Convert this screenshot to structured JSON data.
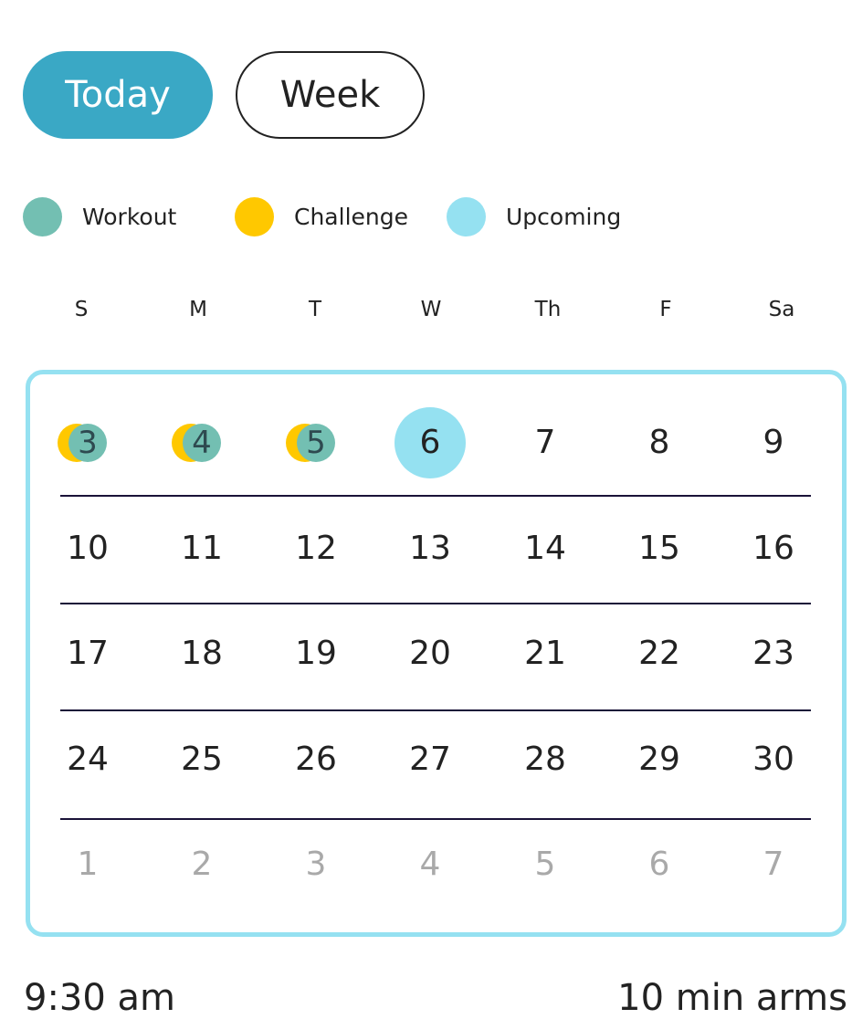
{
  "toggles": {
    "today": "Today",
    "week": "Week"
  },
  "legend": [
    {
      "label": "Workout",
      "color": "#73bfb2"
    },
    {
      "label": "Challenge",
      "color": "#ffc800"
    },
    {
      "label": "Upcoming",
      "color": "#95e1f1"
    }
  ],
  "weekdays": [
    "S",
    "M",
    "T",
    "W",
    "Th",
    "F",
    "Sa"
  ],
  "weeks": [
    [
      "3",
      "4",
      "5",
      "6",
      "7",
      "8",
      "9"
    ],
    [
      "10",
      "11",
      "12",
      "13",
      "14",
      "15",
      "16"
    ],
    [
      "17",
      "18",
      "19",
      "20",
      "21",
      "22",
      "23"
    ],
    [
      "24",
      "25",
      "26",
      "27",
      "28",
      "29",
      "30"
    ],
    [
      "1",
      "2",
      "3",
      "4",
      "5",
      "6",
      "7"
    ]
  ],
  "schedule": {
    "time": "9:30 am",
    "title": "10 min arms"
  }
}
